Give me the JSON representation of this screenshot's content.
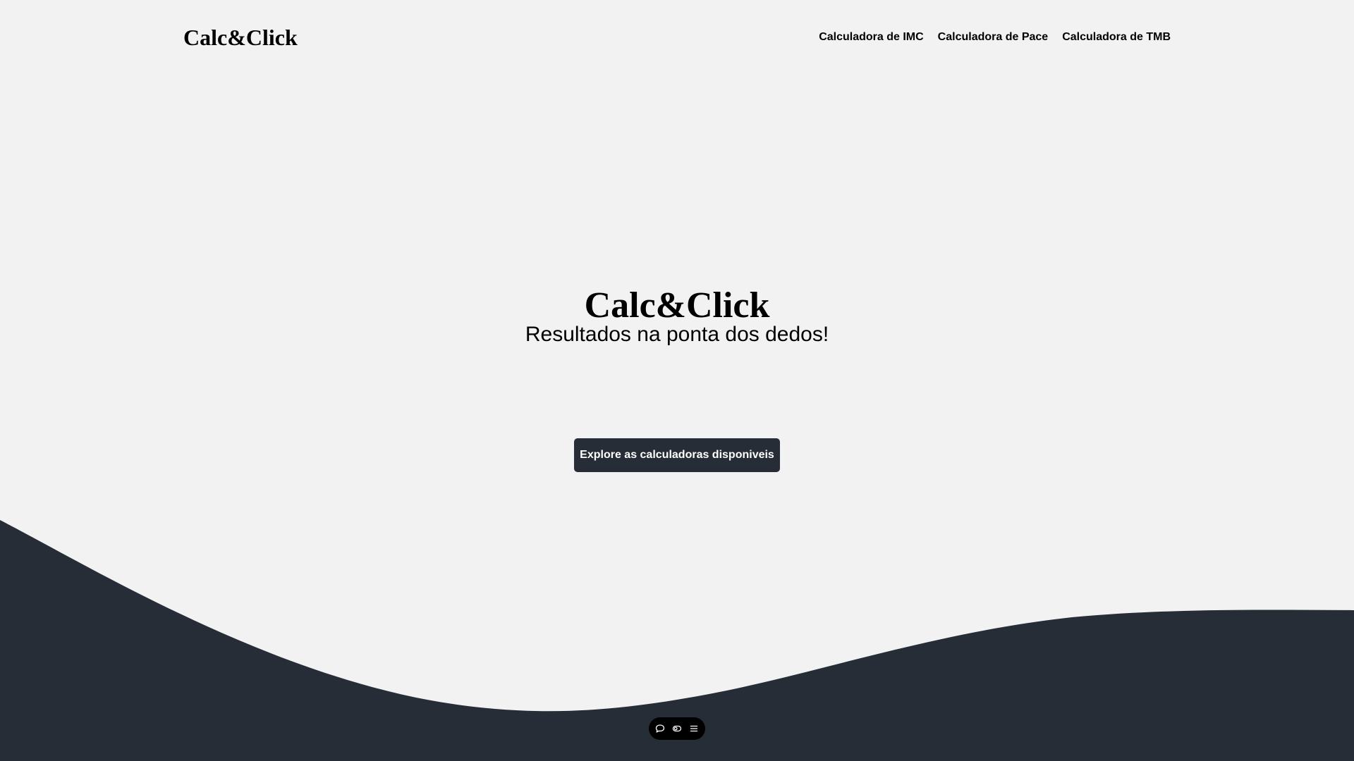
{
  "header": {
    "brand": "Calc&Click",
    "nav": [
      {
        "label": "Calculadora de IMC"
      },
      {
        "label": "Calculadora de Pace"
      },
      {
        "label": "Calculadora de TMB"
      }
    ]
  },
  "hero": {
    "title": "Calc&Click",
    "subtitle": "Resultados na ponta dos dedos!",
    "cta_label": "Explore as calculadoras disponiveis"
  },
  "toolbar": {
    "icons": [
      "chat-bubble-icon",
      "toggle-icon",
      "menu-icon"
    ]
  },
  "colors": {
    "background": "#f2f2f2",
    "dark": "#262d36",
    "text": "#000000",
    "toolbar": "#000000"
  }
}
